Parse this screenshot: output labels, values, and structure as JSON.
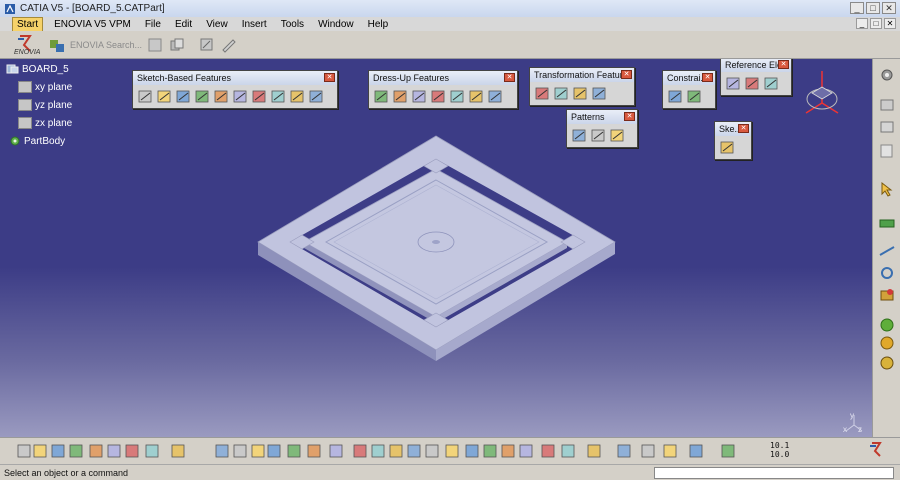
{
  "window": {
    "title": "CATIA V5 - [BOARD_5.CATPart]",
    "controls": [
      "_",
      "□",
      "✕"
    ],
    "doc_controls": [
      "_",
      "□",
      "✕"
    ]
  },
  "menubar": {
    "items": [
      {
        "key": "start",
        "label": "Start"
      },
      {
        "key": "enovia",
        "label": "ENOVIA V5 VPM"
      },
      {
        "key": "file",
        "label": "File"
      },
      {
        "key": "edit",
        "label": "Edit"
      },
      {
        "key": "view",
        "label": "View"
      },
      {
        "key": "insert",
        "label": "Insert"
      },
      {
        "key": "tools",
        "label": "Tools"
      },
      {
        "key": "window",
        "label": "Window"
      },
      {
        "key": "help",
        "label": "Help"
      }
    ]
  },
  "top_toolbar": {
    "enovia_logo_text": "ENOVIA",
    "search_label": "ENOVIA Search..."
  },
  "tree": {
    "root": "BOARD_5",
    "planes": [
      "xy plane",
      "yz plane",
      "zx plane"
    ],
    "body": "PartBody"
  },
  "floating_toolbars": [
    {
      "key": "sketch",
      "title": "Sketch-Based Features",
      "icons": [
        "pad-icon",
        "pocket-icon",
        "shaft-icon",
        "groove-icon",
        "hole-icon",
        "rib-icon",
        "slot-icon",
        "stiffener-icon",
        "multi-section-solid-icon",
        "removed-multi-section-icon"
      ]
    },
    {
      "key": "dressup",
      "title": "Dress-Up Features",
      "icons": [
        "edge-fillet-icon",
        "chamfer-icon",
        "draft-icon",
        "shell-icon",
        "thickness-icon",
        "thread-icon",
        "remove-face-icon"
      ]
    },
    {
      "key": "transform",
      "title": "Transformation Features",
      "icons": [
        "translation-icon",
        "mirror-icon",
        "rect-pattern-icon",
        "scaling-icon"
      ]
    },
    {
      "key": "patterns",
      "title": "Patterns",
      "icons": [
        "rectangular-pattern-icon",
        "circular-pattern-icon",
        "user-pattern-icon"
      ]
    },
    {
      "key": "constraints",
      "title": "Constrai...",
      "icons": [
        "constraint-icon",
        "constraint-dialog-icon"
      ]
    },
    {
      "key": "reference",
      "title": "Reference Ele...",
      "icons": [
        "point-icon",
        "line-icon",
        "plane-icon"
      ]
    },
    {
      "key": "sketcher",
      "title": "Ske...",
      "icons": [
        "sketch-icon"
      ]
    }
  ],
  "bottom_toolbar": {
    "numeric_labels": [
      "10.1",
      "10.0"
    ]
  },
  "status": {
    "message": "Select an object or a command"
  },
  "compass_axes": [
    "x",
    "y",
    "z"
  ],
  "colors": {
    "viewport_top": "#3c3c86",
    "viewport_bottom": "#9a9ac0",
    "part": "#b8bcd8",
    "start_menu": "#f6d26a"
  }
}
